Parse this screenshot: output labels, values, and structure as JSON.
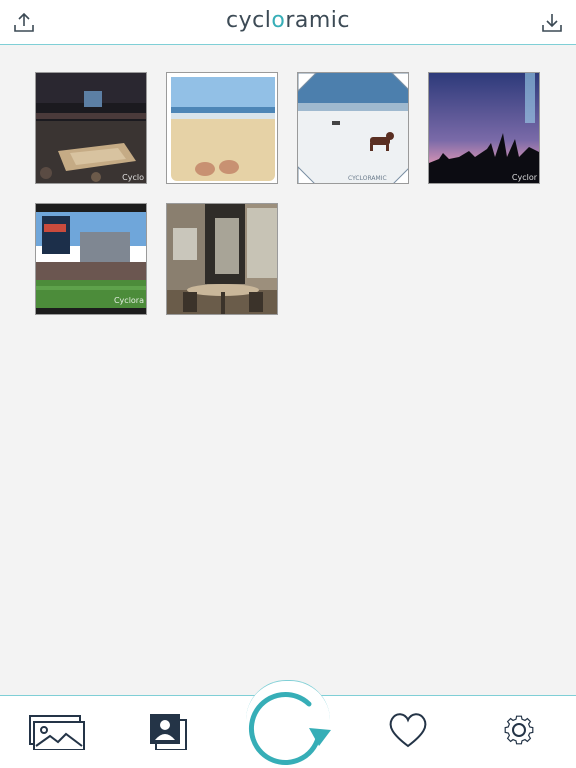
{
  "header": {
    "logo_pre": "cycl",
    "logo_o": "o",
    "logo_post": "ramic",
    "upload_icon": "upload-icon",
    "download_icon": "download-icon"
  },
  "gallery": {
    "items": [
      {
        "name": "photo-arena",
        "watermark": "Cyclo"
      },
      {
        "name": "photo-beach-feet",
        "watermark": ""
      },
      {
        "name": "photo-snow-dog",
        "watermark": "CYCLORAMIC"
      },
      {
        "name": "photo-city-sunset",
        "watermark": "Cyclor"
      },
      {
        "name": "photo-ballpark",
        "watermark": "Cyclora"
      },
      {
        "name": "photo-office",
        "watermark": ""
      }
    ]
  },
  "tabbar": {
    "items": [
      "gallery-icon",
      "portrait-icon",
      "cycle-icon",
      "heart-icon",
      "settings-icon"
    ]
  },
  "colors": {
    "accent": "#36aeb7",
    "dark": "#243447",
    "divider": "#7fcfd6"
  }
}
